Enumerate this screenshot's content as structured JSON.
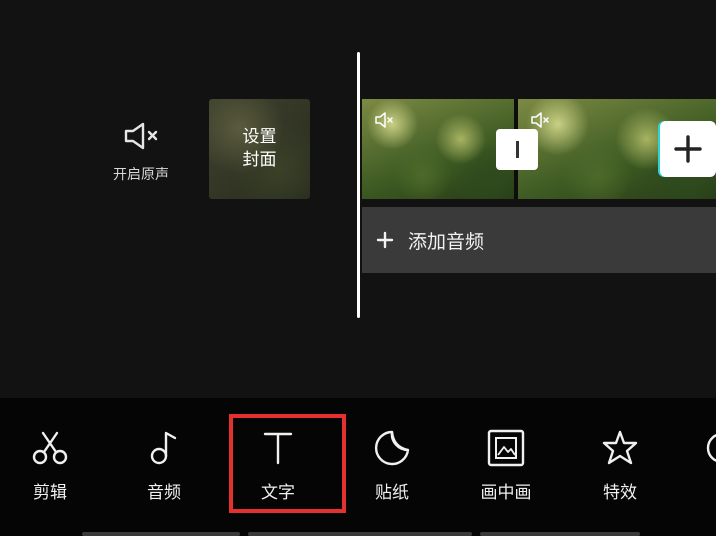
{
  "editor": {
    "mute_label": "开启原声",
    "cover_line1": "设置",
    "cover_line2": "封面",
    "add_audio_label": "添加音频",
    "icons": {
      "mute": "speaker-mute-icon",
      "transition": "transition-icon",
      "add_clip": "plus-icon",
      "add_audio": "plus-icon"
    }
  },
  "toolbar": {
    "tools": [
      {
        "label": "剪辑",
        "icon": "scissors-icon"
      },
      {
        "label": "音频",
        "icon": "music-note-icon"
      },
      {
        "label": "文字",
        "icon": "text-icon"
      },
      {
        "label": "贴纸",
        "icon": "sticker-icon"
      },
      {
        "label": "画中画",
        "icon": "picture-in-picture-icon"
      },
      {
        "label": "特效",
        "icon": "effects-star-icon"
      }
    ],
    "highlighted_tool": "文字",
    "highlight_color": "#e53030"
  }
}
